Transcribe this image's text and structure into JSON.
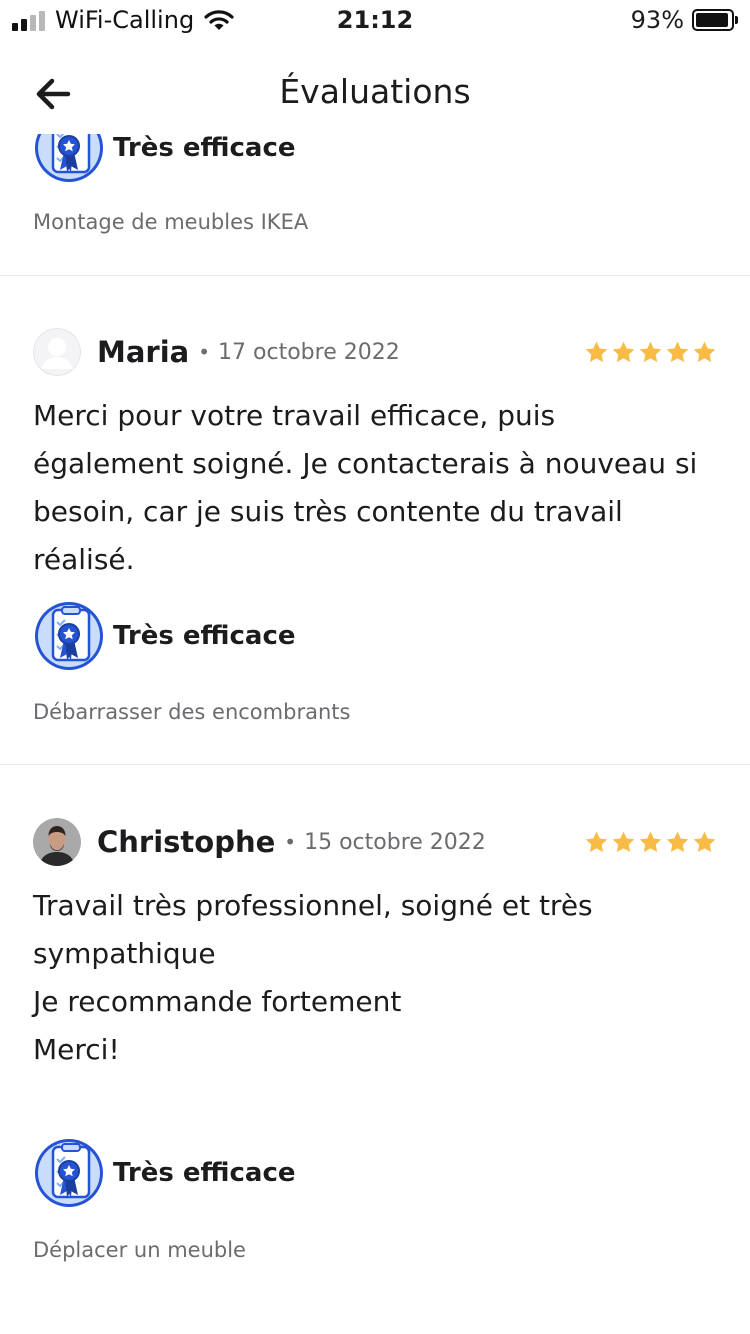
{
  "status_bar": {
    "carrier": "WiFi-Calling",
    "time": "21:12",
    "battery": "93%",
    "battery_level": 0.93
  },
  "header": {
    "title": "Évaluations",
    "back_icon": "arrow-left-icon"
  },
  "colors": {
    "star": "#f8bb45",
    "badge_blue": "#2553d6",
    "divider": "#ebebeb",
    "muted_text": "#6b6b70"
  },
  "partial_review": {
    "badge": "Très efficace",
    "category": "Montage de meubles IKEA"
  },
  "reviews": [
    {
      "name": "Maria",
      "separator": "•",
      "date": "17 octobre 2022",
      "rating": 5,
      "text": "Merci pour votre travail efficace, puis\négalement soigné. Je contacterais à nouveau si\nbesoin, car je suis très contente du travail\nréalisé.",
      "badge": "Très efficace",
      "category": "Débarrasser des encombrants",
      "avatar": "default-avatar-icon"
    },
    {
      "name": "Christophe",
      "separator": "•",
      "date": "15 octobre 2022",
      "rating": 5,
      "text": "Travail très professionnel, soigné et très\nsympathique\nJe recommande fortement\nMerci!",
      "badge": "Très efficace",
      "category": "Déplacer un meuble",
      "avatar": "user-photo-avatar"
    }
  ]
}
